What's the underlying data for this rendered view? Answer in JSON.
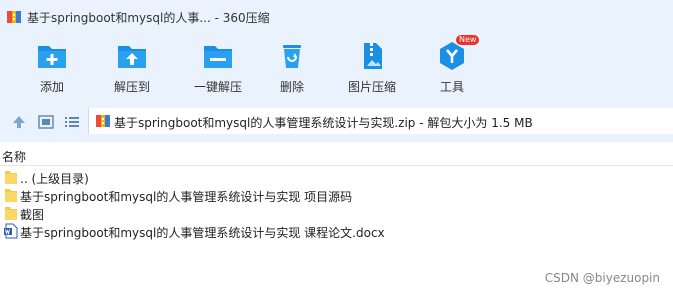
{
  "window": {
    "title": "基于springboot和mysql的人事... - 360压缩"
  },
  "toolbar": {
    "items": [
      {
        "label": "添加",
        "icon": "add-icon"
      },
      {
        "label": "解压到",
        "icon": "extract-to-icon"
      },
      {
        "label": "一键解压",
        "icon": "one-click-extract-icon"
      },
      {
        "label": "删除",
        "icon": "delete-icon"
      },
      {
        "label": "图片压缩",
        "icon": "image-compress-icon"
      },
      {
        "label": "工具",
        "icon": "tools-icon",
        "badge": "New"
      }
    ]
  },
  "address": {
    "path": "基于springboot和mysql的人事管理系统设计与实现.zip - 解包大小为 1.5 MB"
  },
  "list": {
    "column_name": "名称",
    "items": [
      {
        "name": ".. (上级目录)",
        "type": "folder"
      },
      {
        "name": "基于springboot和mysql的人事管理系统设计与实现 项目源码",
        "type": "folder"
      },
      {
        "name": "截图",
        "type": "folder"
      },
      {
        "name": "基于springboot和mysql的人事管理系统设计与实现 课程论文.docx",
        "type": "docx"
      }
    ]
  },
  "watermark": "CSDN @biyezuopin",
  "colors": {
    "toolbar_bg": "#eaf3fd",
    "icon_blue": "#1a8fe3",
    "folder_yellow": "#f7c948",
    "badge_red": "#e8332a"
  }
}
